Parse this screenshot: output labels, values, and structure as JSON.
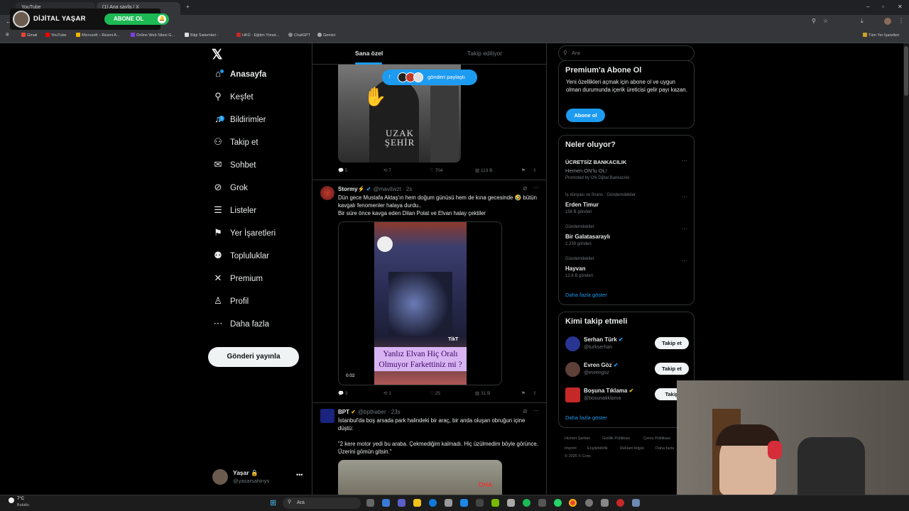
{
  "channel": {
    "name": "DİJİTAL YAŞAR",
    "subscribe_label": "ABONE OL"
  },
  "browser": {
    "tabs": [
      "YouTube",
      "(1) Ana sayfa / X"
    ],
    "bookmarks": [
      "Gmail",
      "YouTube",
      "Microsoft – Resmi A...",
      "Online Web Sitesi G...",
      "Bilgi Sistemleri -",
      "HKÜ - Eğitim Yönet...",
      "ChatGPT",
      "Gemini"
    ],
    "all_bookmarks_label": "Tüm Yer İşaretleri"
  },
  "sidebar": {
    "items": [
      {
        "label": "Anasayfa",
        "icon": "home-icon",
        "glyph": "⌂"
      },
      {
        "label": "Keşfet",
        "icon": "search-icon",
        "glyph": "⚲"
      },
      {
        "label": "Bildirimler",
        "icon": "bell-icon",
        "glyph": "♫"
      },
      {
        "label": "Takip et",
        "icon": "add-user-icon",
        "glyph": "⚇"
      },
      {
        "label": "Sohbet",
        "icon": "mail-icon",
        "glyph": "✉"
      },
      {
        "label": "Grok",
        "icon": "grok-icon",
        "glyph": "⊘"
      },
      {
        "label": "Listeler",
        "icon": "list-icon",
        "glyph": "☰"
      },
      {
        "label": "Yer İşaretleri",
        "icon": "bookmark-icon",
        "glyph": "⚑"
      },
      {
        "label": "Topluluklar",
        "icon": "communities-icon",
        "glyph": "⚉"
      },
      {
        "label": "Premium",
        "icon": "x-premium-icon",
        "glyph": "✕"
      },
      {
        "label": "Profil",
        "icon": "profile-icon",
        "glyph": "♙"
      },
      {
        "label": "Daha fazla",
        "icon": "more-icon",
        "glyph": "⋯"
      }
    ],
    "notif_badge": "1",
    "post_button": "Gönderi yayınla",
    "user": {
      "name": "Yaşar 🔒",
      "handle": "@yasarsahinys"
    }
  },
  "feed": {
    "tabs": [
      "Sana özel",
      "Takip ediliyor"
    ],
    "share_pill": "gönderi paylaştı",
    "tweet1": {
      "image_text": "UZAK ŞEHİR",
      "actions": {
        "replies": "5",
        "reposts": "7",
        "likes": "704",
        "views": "113 B"
      }
    },
    "tweet2": {
      "name": "Stormy⚡",
      "handle": "@mavitwzt · 2s",
      "text1": "Dün gece Mustafa Aktaş'ın hem doğum günüsü hem de kına gecesinde 🤣 bütün kavgalı fenomenler halaya durdu..",
      "text2": "Bir süre önce kavga eden Dilan Polat ve Elvan halay çektiler",
      "video_caption": "Yanlız Elvan Hiç Oralı Olmuyor Farkettiniz mi ?",
      "video_time": "0:02",
      "video_brand": "TikT",
      "actions": {
        "replies": "3",
        "reposts": "1",
        "likes": "25",
        "views": "31 B"
      }
    },
    "tweet3": {
      "name": "BPT",
      "handle": "@bpthaber · 23s",
      "text1": "İstanbul'da boş arsada park halindeki bir araç, bir anda oluşan obruğun içine düştü:",
      "text2": "\"2 kere motor yedi bu araba. Çekmediğim kalmadı. Hiç üzülmedim böyle görünce. Üzerini gömün gitsin.\"",
      "image_brand": "DHA"
    }
  },
  "right": {
    "search_placeholder": "Ara",
    "premium": {
      "title": "Premium'a Abone Ol",
      "text": "Yeni özellikleri açmak için abone ol ve uygun olman durumunda içerik üreticisi gelir payı kazan.",
      "button": "Abone ol"
    },
    "trends": {
      "title": "Neler oluyor?",
      "items": [
        {
          "context": "",
          "name": "ÜCRETSİZ BANKACILIK",
          "sub": "Hemen ON'lu OL!",
          "meta": "Promoted by ON Dijital Bankacılık"
        },
        {
          "context": "İş dünyası ve finans · Gündemdekiler",
          "name": "Erden Timur",
          "sub": "",
          "meta": "158 B gönderi"
        },
        {
          "context": "Gündemdekiler",
          "name": "Bir Galatasaraylı",
          "sub": "",
          "meta": "2.239 gönderi"
        },
        {
          "context": "Gündemdekiler",
          "name": "Hayvan",
          "sub": "",
          "meta": "12,6 B gönderi"
        }
      ],
      "show_more": "Daha fazla göster"
    },
    "who": {
      "title": "Kimi takip etmeli",
      "users": [
        {
          "name": "Serhan Türk",
          "handle": "@turkserhan",
          "button": "Takip et"
        },
        {
          "name": "Evren Göz",
          "handle": "@evrengoz",
          "button": "Takip et"
        },
        {
          "name": "Boşuna Tıklama",
          "handle": "@bosunatiklama",
          "button": "Takip"
        }
      ],
      "show_more": "Daha fazla göster"
    },
    "footer": [
      "Hizmet Şartları",
      "Gizlilik Politikası",
      "Çerez Politikası",
      "Imprint",
      "Erişilebilirlik",
      "Reklam bilgisi",
      "Daha fazla",
      "© 2025 X Corp."
    ]
  },
  "taskbar": {
    "weather_temp": "7°C",
    "weather_desc": "Bulutlu",
    "search": "Ara"
  }
}
